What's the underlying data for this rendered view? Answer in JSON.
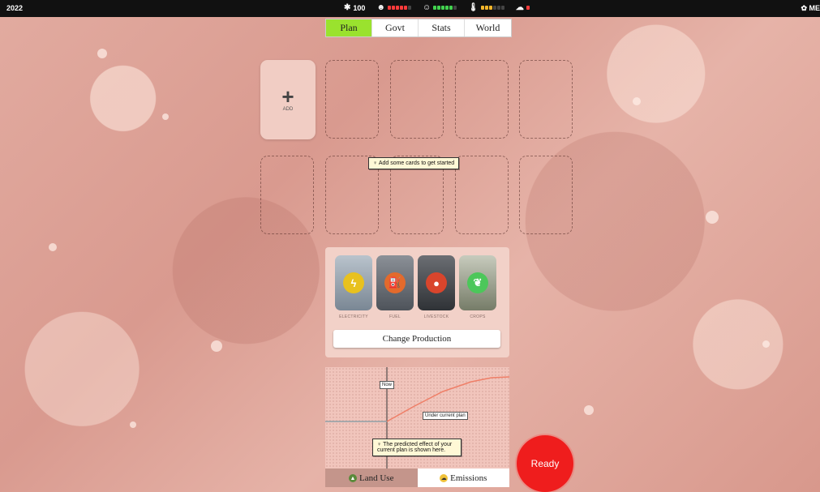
{
  "topbar": {
    "year": "2022",
    "stats": [
      {
        "icon": "political-capital-icon",
        "glyph": "✱",
        "value": "100",
        "color": "#ffffff"
      },
      {
        "icon": "skull-icon",
        "glyph": "☻",
        "pips": [
          "#ff3b3b",
          "#ff3b3b",
          "#ff3b3b",
          "#ff3b3b",
          "#ff3b3b",
          "#444444"
        ]
      },
      {
        "icon": "smile-icon",
        "glyph": "☺",
        "pips": [
          "#42d24f",
          "#42d24f",
          "#42d24f",
          "#42d24f",
          "#42d24f",
          "#444444"
        ]
      },
      {
        "icon": "thermometer-icon",
        "glyph": "🌡",
        "pips": [
          "#f5b62a",
          "#f5b62a",
          "#f5b62a",
          "#444444",
          "#444444",
          "#444444"
        ]
      },
      {
        "icon": "cloud-icon",
        "glyph": "☁",
        "pips": [
          "#ff3b3b"
        ]
      }
    ],
    "menu_label": "ME"
  },
  "tabs": [
    {
      "label": "Plan",
      "active": true
    },
    {
      "label": "Govt",
      "active": false
    },
    {
      "label": "Stats",
      "active": false
    },
    {
      "label": "World",
      "active": false
    }
  ],
  "add_card": {
    "plus": "+",
    "label": "ADD"
  },
  "tip_cards": "Add some cards to get started",
  "production": {
    "items": [
      {
        "label": "ELECTRICITY",
        "icon": "lightning-icon",
        "glyph": "ϟ",
        "icon_color": "#e8c11e",
        "bg": "#8c9aa5"
      },
      {
        "label": "FUEL",
        "icon": "fuel-pump-icon",
        "glyph": "⛽",
        "icon_color": "#e36a2c",
        "bg": "#6a6f76"
      },
      {
        "label": "LIVESTOCK",
        "icon": "livestock-icon",
        "glyph": "●",
        "icon_color": "#d9452c",
        "bg": "#4a4d52"
      },
      {
        "label": "CROPS",
        "icon": "leaf-icon",
        "glyph": "❦",
        "icon_color": "#4cc75a",
        "bg": "#9aa08a"
      }
    ],
    "button": "Change Production"
  },
  "chart": {
    "now_label": "Now",
    "plan_label": "Under current plan",
    "tip": "The predicted effect of your current plan is shown here.",
    "tabs": [
      {
        "label": "Land Use",
        "icon": "land-use-icon",
        "active": true
      },
      {
        "label": "Emissions",
        "icon": "emissions-icon",
        "active": false
      }
    ]
  },
  "ready_label": "Ready"
}
